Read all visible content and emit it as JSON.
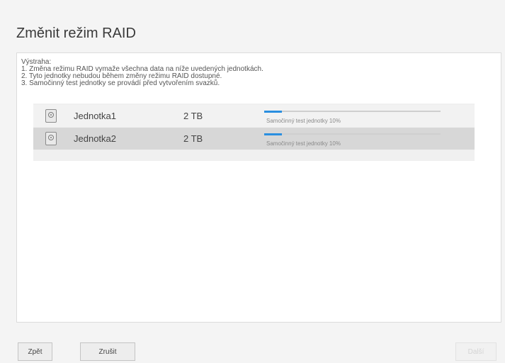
{
  "dialog": {
    "title": "Změnit režim RAID"
  },
  "warning": {
    "heading": "Výstraha:",
    "lines": [
      "1. Změna režimu RAID vymaže všechna data na níže uvedených jednotkách.",
      "2. Tyto jednotky nebudou během změny režimu RAID dostupné.",
      "3. Samočinný test jednotky se provádí před vytvořením svazků."
    ]
  },
  "drives": [
    {
      "name": "Jednotka1",
      "size": "2 TB",
      "status": "Samočinný test jednotky 10%",
      "progress": 0.1,
      "icon": "hard-drive-icon"
    },
    {
      "name": "Jednotka2",
      "size": "2 TB",
      "status": "Samočinný test jednotky 10%",
      "progress": 0.1,
      "icon": "hard-drive-icon"
    }
  ],
  "footer": {
    "back_label": "Zpět",
    "cancel_label": "Zrušit",
    "next_label": "Další"
  },
  "colors": {
    "progress_accent": "#2a8fe0"
  }
}
